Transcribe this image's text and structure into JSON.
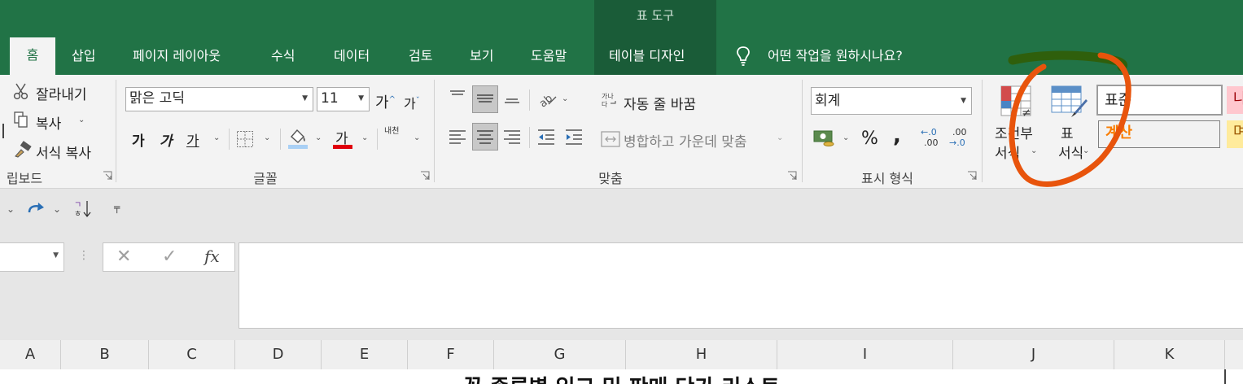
{
  "context_tab_group": "표 도구",
  "tabs": [
    {
      "id": "home",
      "label": "홈",
      "active": true
    },
    {
      "id": "insert",
      "label": "삽입"
    },
    {
      "id": "page-layout",
      "label": "페이지 레이아웃"
    },
    {
      "id": "formulas",
      "label": "수식"
    },
    {
      "id": "data",
      "label": "데이터"
    },
    {
      "id": "review",
      "label": "검토"
    },
    {
      "id": "view",
      "label": "보기"
    },
    {
      "id": "help",
      "label": "도움말"
    },
    {
      "id": "table-design",
      "label": "테이블 디자인"
    }
  ],
  "tell_me": "어떤 작업을 원하시나요?",
  "clipboard": {
    "cut": "잘라내기",
    "copy": "복사",
    "format_painter": "서식 복사",
    "group_label": "립보드"
  },
  "font": {
    "name": "맑은 고딕",
    "size": "11",
    "grow": "가",
    "shrink": "가",
    "bold": "가",
    "italic": "가",
    "underline": "가",
    "color_glyph": "가",
    "phonetic": "내천",
    "group_label": "글꼴"
  },
  "alignment": {
    "wrap_text": "자동 줄 바꿈",
    "merge_center": "병합하고 가운데 맞춤",
    "group_label": "맞춤"
  },
  "number": {
    "format": "회계",
    "percent": "%",
    "comma": ",",
    "inc_decimal_top": "←.0",
    "inc_decimal_bottom": ".00",
    "dec_decimal_top": ".00",
    "dec_decimal_bottom": "→.0",
    "group_label": "표시 형식"
  },
  "styles": {
    "conditional_top": "조건부",
    "conditional_bottom": "서식",
    "table_top": "표",
    "table_bottom": "서식",
    "normal": "표준",
    "calc": "계산",
    "bad_partial": "나",
    "neutral_partial": "며"
  },
  "formula_bar": {
    "fx": "fx",
    "cancel": "✕",
    "enter": "✓"
  },
  "columns": [
    "A",
    "B",
    "C",
    "D",
    "E",
    "F",
    "G",
    "H",
    "I",
    "J",
    "K"
  ],
  "sheet_title_partial": "꽃 종류별 입고 및 판매 단가 리스트",
  "colors": {
    "excel_green": "#217346",
    "annotation_orange": "#e8540c",
    "annotation_green": "#2f5f0c",
    "calc_text": "#fa7d00",
    "bad_fill": "#ffc7ce",
    "neutral_fill": "#ffeb9c"
  }
}
